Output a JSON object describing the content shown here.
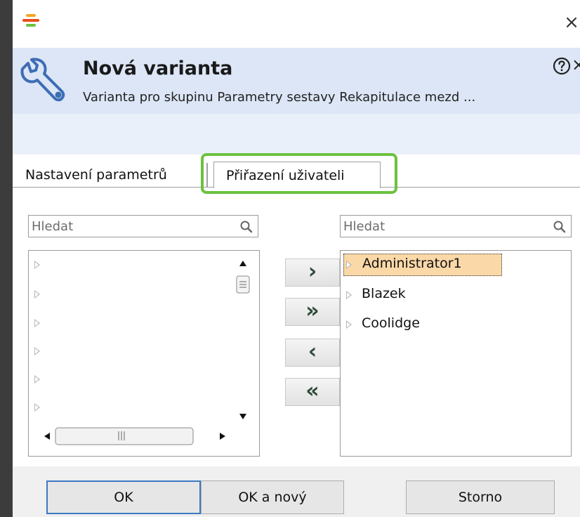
{
  "window": {
    "close_glyph": "×",
    "logo_colors": [
      "#f5a623",
      "#e94e1b",
      "#6cc23f"
    ]
  },
  "header": {
    "title": "Nová varianta",
    "subtitle": "Varianta pro skupinu Parametry sestavy Rekapitulace mezd ...",
    "close_glyph": "×",
    "background": "#dce6f6"
  },
  "tabs": [
    {
      "label": "Nastavení parametrů",
      "active": false
    },
    {
      "label": "Přiřazení uživateli",
      "active": true
    }
  ],
  "highlight_color": "#6cc23f",
  "left_panel": {
    "search_placeholder": "Hledat",
    "item_count": 6
  },
  "right_panel": {
    "search_placeholder": "Hledat",
    "items": [
      {
        "label": "Administrator1",
        "selected": true
      },
      {
        "label": "Blazek",
        "selected": false
      },
      {
        "label": "Coolidge",
        "selected": false
      }
    ],
    "selection_color": "#fbd8a8"
  },
  "move_buttons": {
    "add": "›",
    "add_all": "»",
    "remove": "‹",
    "remove_all": "«"
  },
  "footer": {
    "ok": "OK",
    "ok_new": "OK a nový",
    "cancel": "Storno"
  }
}
